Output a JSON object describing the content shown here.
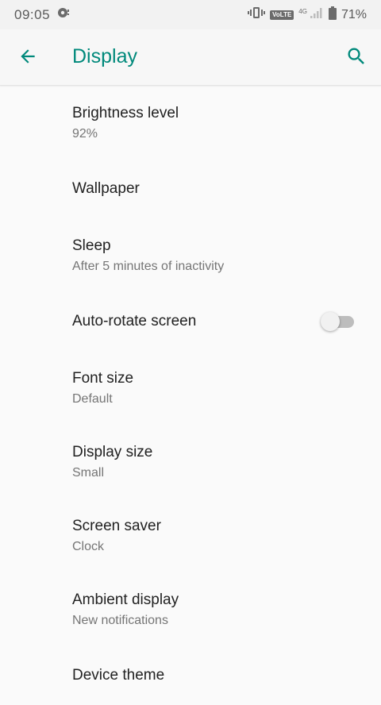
{
  "status_bar": {
    "time": "09:05",
    "network_badge": "VoLTE",
    "network_type": "4G",
    "battery": "71%"
  },
  "app_bar": {
    "title": "Display",
    "accent_color": "#00897b"
  },
  "settings": [
    {
      "title": "Brightness level",
      "summary": "92%"
    },
    {
      "title": "Wallpaper"
    },
    {
      "title": "Sleep",
      "summary": "After 5 minutes of inactivity"
    },
    {
      "title": "Auto-rotate screen",
      "toggle_on": false
    },
    {
      "title": "Font size",
      "summary": "Default"
    },
    {
      "title": "Display size",
      "summary": "Small"
    },
    {
      "title": "Screen saver",
      "summary": "Clock"
    },
    {
      "title": "Ambient display",
      "summary": "New notifications"
    },
    {
      "title": "Device theme"
    }
  ]
}
